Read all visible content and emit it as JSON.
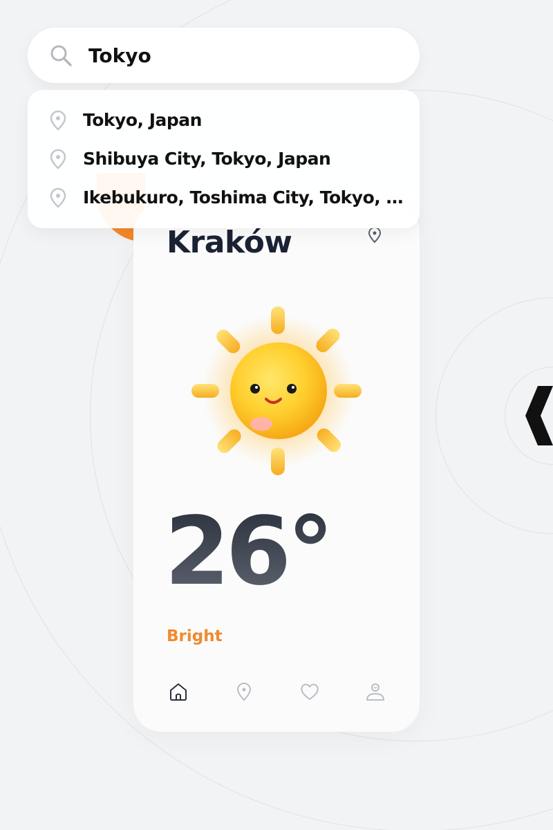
{
  "search": {
    "value": "Tokyo",
    "results": [
      "Tokyo, Japan",
      "Shibuya City, Tokyo, Japan",
      "Ikebukuro, Toshima City, Tokyo, Japan"
    ]
  },
  "weather": {
    "city": "Kraków",
    "temperature": "26°",
    "condition": "Bright",
    "illustration": "smiling-sun"
  },
  "nav": {
    "items": [
      {
        "name": "home",
        "icon": "home-icon",
        "active": true
      },
      {
        "name": "location",
        "icon": "location-pin-icon",
        "active": false
      },
      {
        "name": "favorites",
        "icon": "heart-icon",
        "active": false
      },
      {
        "name": "profile",
        "icon": "user-icon",
        "active": false
      }
    ]
  },
  "colors": {
    "accent": "#f08a2e",
    "temperature_dark": "#2b313d",
    "background": "#f2f3f5",
    "card": "#fbfbfb"
  }
}
